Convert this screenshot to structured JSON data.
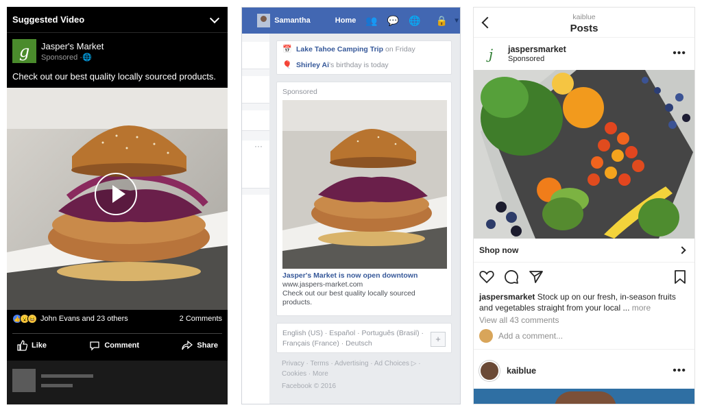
{
  "panel_left": {
    "header_title": "Suggested Video",
    "page_logo_letter": "g",
    "page_name": "Jasper's Market",
    "sponsored": "Sponsored",
    "description": "Check out our best quality locally sourced products.",
    "reactions_text": "John Evans and 23 others",
    "comments_count": "2 Comments",
    "like_label": "Like",
    "comment_label": "Comment",
    "share_label": "Share",
    "colors": {
      "logo_green": "#4a8b2c",
      "background": "#000000"
    }
  },
  "panel_middle": {
    "user_name": "Samantha",
    "home_label": "Home",
    "events": [
      {
        "title": "Lake Tahoe Camping Trip",
        "detail": "on Friday"
      },
      {
        "title": "Shirley Ai",
        "detail": "'s birthday is today"
      }
    ],
    "sponsored_label": "Sponsored",
    "ad_title": "Jasper's Market is now open downtown",
    "ad_url": "www.jaspers-market.com",
    "ad_description": "Check out our best quality locally sourced products.",
    "languages": "English (US) · Español · Português (Brasil) · Français (France) · Deutsch",
    "plus_label": "+",
    "footer_links": "Privacy · Terms · Advertising · Ad Choices ▷ · Cookies · More",
    "copyright": "Facebook © 2016",
    "more_dots": "···",
    "colors": {
      "topbar": "#4267b2",
      "link": "#365899"
    }
  },
  "panel_right": {
    "username_top": "kaiblue",
    "title": "Posts",
    "account": "jaspersmarket",
    "logo_letter": "j",
    "sponsored": "Sponsored",
    "more_dots": "•••",
    "shop_now": "Shop now",
    "caption_user": "jaspersmarket",
    "caption_text": " Stock up on our fresh, in-season fruits and vegetables straight from your local ...",
    "caption_more": " more",
    "view_all": "View all 43 comments",
    "add_comment": "Add a comment...",
    "next_user": "kaiblue"
  }
}
